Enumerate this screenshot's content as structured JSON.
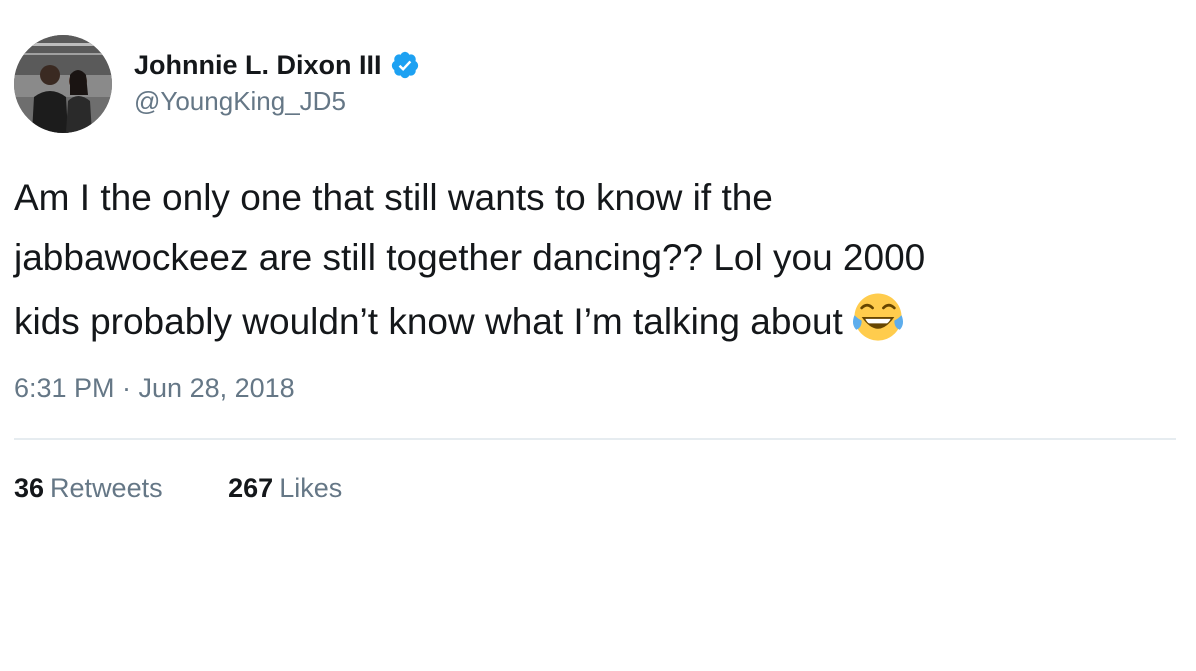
{
  "author": {
    "display_name": "Johnnie L. Dixon III",
    "handle": "@YoungKing_JD5",
    "verified": true,
    "avatar": "profile-photo"
  },
  "tweet": {
    "lines": [
      "Am I the only one that still wants to know if the",
      "jabbawockeez are still together dancing?? Lol you 2000",
      "kids probably wouldn’t know what I’m talking about"
    ],
    "emoji": "face-with-tears-of-joy"
  },
  "timestamp": "6:31 PM · Jun 28, 2018",
  "stats": {
    "retweets_count": "36",
    "retweets_label": "Retweets",
    "likes_count": "267",
    "likes_label": "Likes"
  },
  "colors": {
    "text": "#14171a",
    "secondary": "#657786",
    "verified_blue": "#1da1f2",
    "divider": "#e6ecf0"
  }
}
